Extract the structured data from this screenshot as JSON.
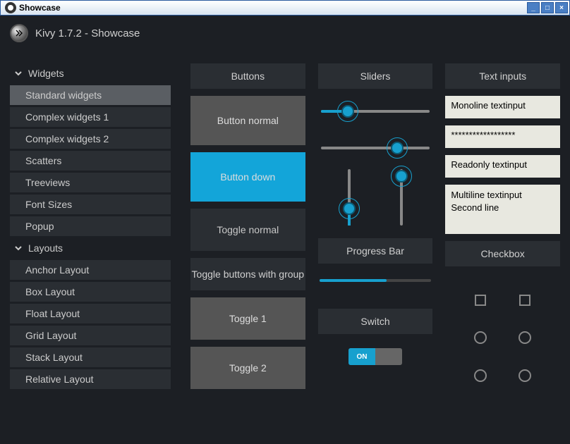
{
  "window": {
    "title": "Showcase"
  },
  "header": {
    "title": "Kivy 1.7.2 - Showcase"
  },
  "sidebar": {
    "sections": [
      {
        "label": "Widgets",
        "items": [
          {
            "label": "Standard widgets",
            "active": true
          },
          {
            "label": "Complex widgets 1"
          },
          {
            "label": "Complex widgets 2"
          },
          {
            "label": "Scatters"
          },
          {
            "label": "Treeviews"
          },
          {
            "label": "Font Sizes"
          },
          {
            "label": "Popup"
          }
        ]
      },
      {
        "label": "Layouts",
        "items": [
          {
            "label": "Anchor Layout"
          },
          {
            "label": "Box Layout"
          },
          {
            "label": "Float Layout"
          },
          {
            "label": "Grid Layout"
          },
          {
            "label": "Stack Layout"
          },
          {
            "label": "Relative Layout"
          }
        ]
      }
    ]
  },
  "buttons": {
    "header": "Buttons",
    "normal": "Button normal",
    "down": "Button down",
    "toggle_normal": "Toggle normal",
    "toggle_group_label": "Toggle buttons with group",
    "toggle1": "Toggle 1",
    "toggle2": "Toggle 2"
  },
  "sliders": {
    "header": "Sliders",
    "h1_value_pct": 25,
    "h2_value_pct": 70,
    "v1_value_pct": 30,
    "v2_value_pct": 88,
    "progress_header": "Progress Bar",
    "progress_pct": 60,
    "switch_header": "Switch",
    "switch_on_label": "ON",
    "switch_state": true
  },
  "textinputs": {
    "header": "Text inputs",
    "monoline": "Monoline textinput",
    "password": "******************",
    "readonly": "Readonly textinput",
    "multiline": "Multiline textinput\nSecond line",
    "checkbox_header": "Checkbox"
  },
  "colors": {
    "accent": "#17a0ce",
    "bg": "#1c1f24",
    "button": "#555",
    "panel": "#2a2e33"
  }
}
